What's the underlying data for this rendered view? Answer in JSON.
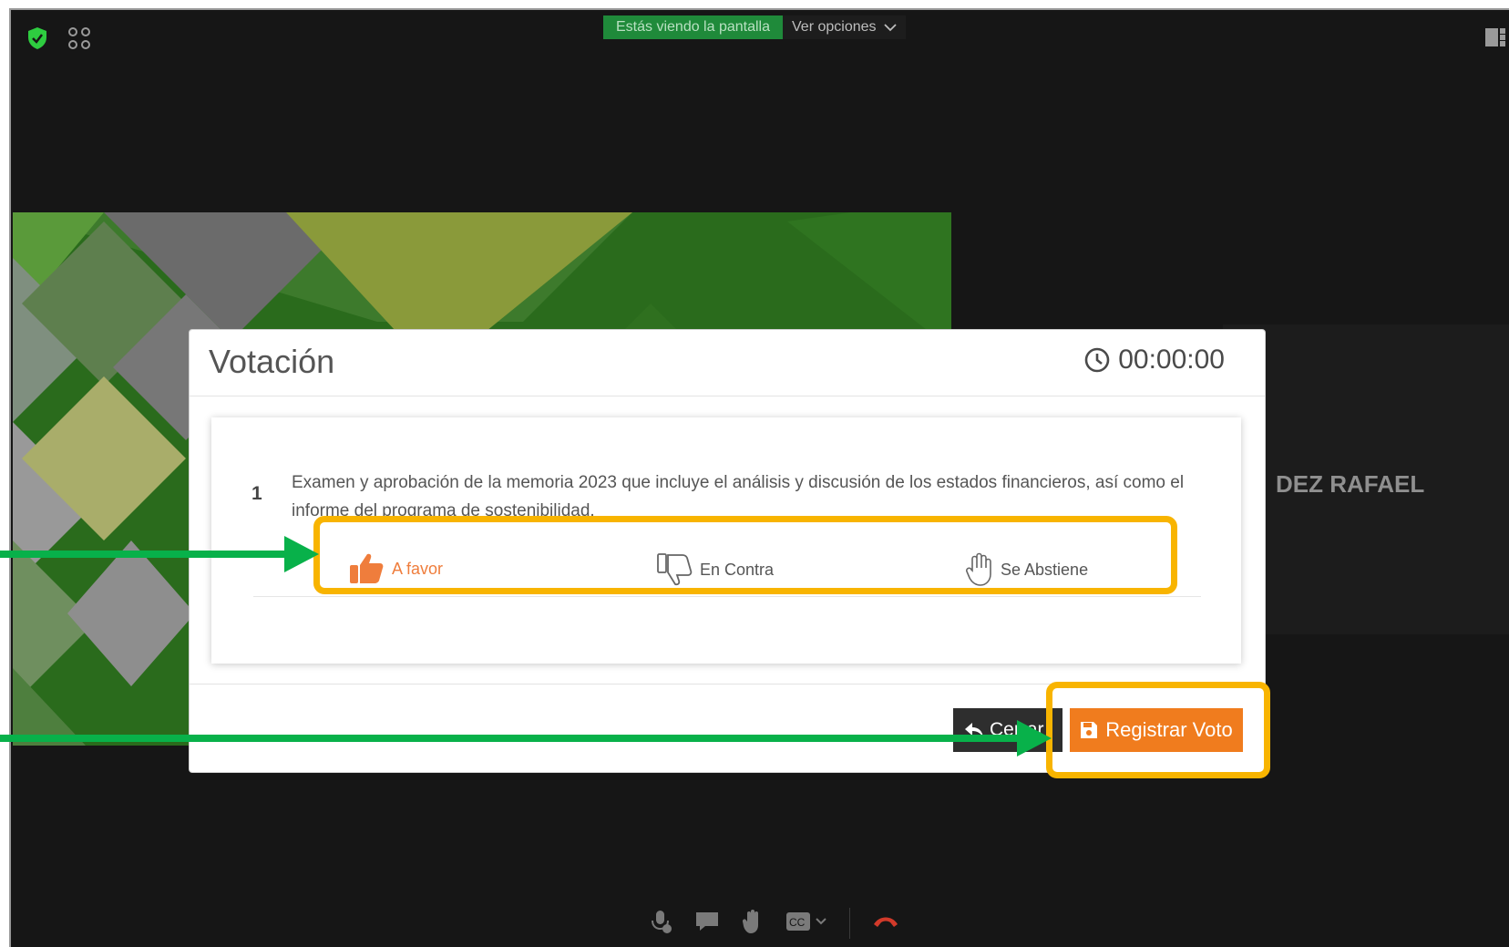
{
  "meeting": {
    "banner_viewing": "Estás viendo la pantalla",
    "banner_options": "Ver opciones",
    "participant_name": "DEZ RAFAEL"
  },
  "modal": {
    "title": "Votación",
    "timer": "00:00:00",
    "question": {
      "number": "1",
      "text": "Examen y aprobación de la memoria 2023 que incluye el análisis y discusión de los estados financieros, así como el informe del programa de sostenibilidad."
    },
    "options": [
      {
        "label": "A favor"
      },
      {
        "label": "En Contra"
      },
      {
        "label": "Se Abstiene"
      }
    ],
    "cancel_label": "Cerrar",
    "submit_label": "Registrar Voto"
  },
  "colors": {
    "accent_orange": "#f07c1e",
    "highlight": "#f8b400",
    "arrow": "#08b14a",
    "shield_green": "#2ecc40"
  },
  "icons": [
    "shield-check-icon",
    "grid-icon",
    "clock-icon",
    "thumbs-up-icon",
    "thumbs-down-icon",
    "hand-icon",
    "save-icon",
    "back-arrow-icon",
    "mic-icon",
    "chat-icon",
    "raise-hand-icon",
    "cc-icon",
    "hang-up-icon"
  ]
}
